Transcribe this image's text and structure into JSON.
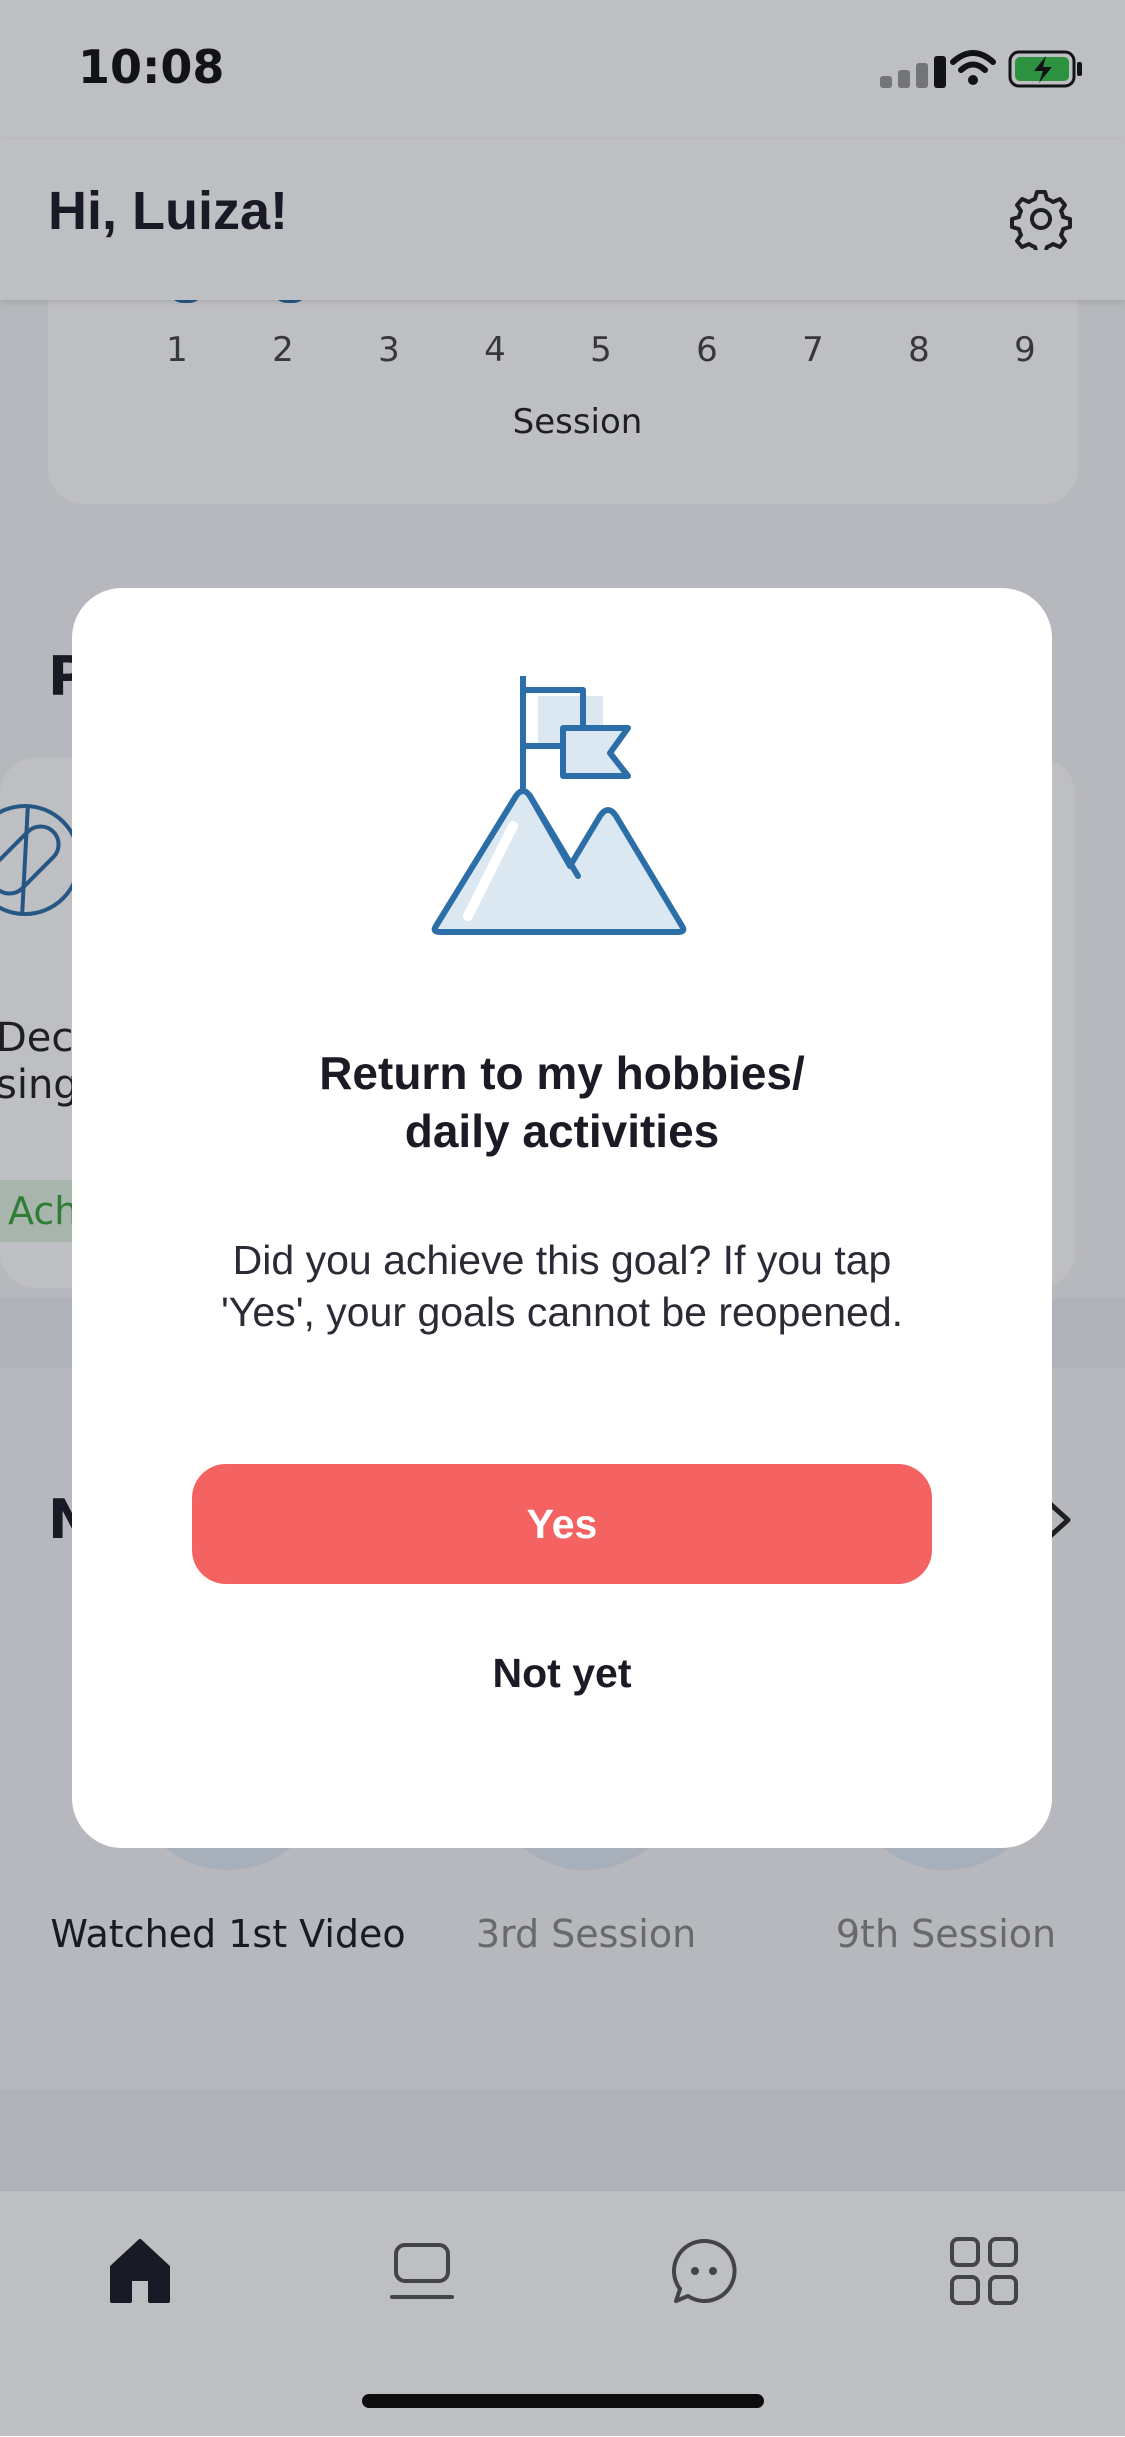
{
  "status_bar": {
    "time": "10:08"
  },
  "header": {
    "greeting": "Hi, Luiza!"
  },
  "session_chart": {
    "ticks": [
      "1",
      "2",
      "3",
      "4",
      "5",
      "6",
      "7",
      "8",
      "9"
    ],
    "xlabel": "Session"
  },
  "goals_section": {
    "title_partial": "P",
    "goal_text_line1": "Decr",
    "goal_text_line2": "sing",
    "badge": "Ach"
  },
  "milestones_section": {
    "title_partial": "N",
    "items": [
      {
        "label": "Watched 1st Video",
        "achieved": true
      },
      {
        "label": "3rd Session",
        "achieved": false
      },
      {
        "label": "9th Session",
        "achieved": false
      }
    ]
  },
  "modal": {
    "icon": "mountain-flag-icon",
    "title_line1": "Return to my hobbies/",
    "title_line2": "daily activities",
    "body_line1": "Did you achieve this goal? If you tap",
    "body_line2": "'Yes', your goals cannot be reopened.",
    "yes_label": "Yes",
    "not_yet_label": "Not yet"
  },
  "tab_bar": {
    "tabs": [
      {
        "icon": "home-icon",
        "active": true
      },
      {
        "icon": "laptop-icon",
        "active": false
      },
      {
        "icon": "chat-icon",
        "active": false
      },
      {
        "icon": "grid-icon",
        "active": false
      }
    ]
  },
  "colors": {
    "accent": "#f46262",
    "icon_blue": "#2c6ea8",
    "text_dark": "#1b1b26"
  }
}
